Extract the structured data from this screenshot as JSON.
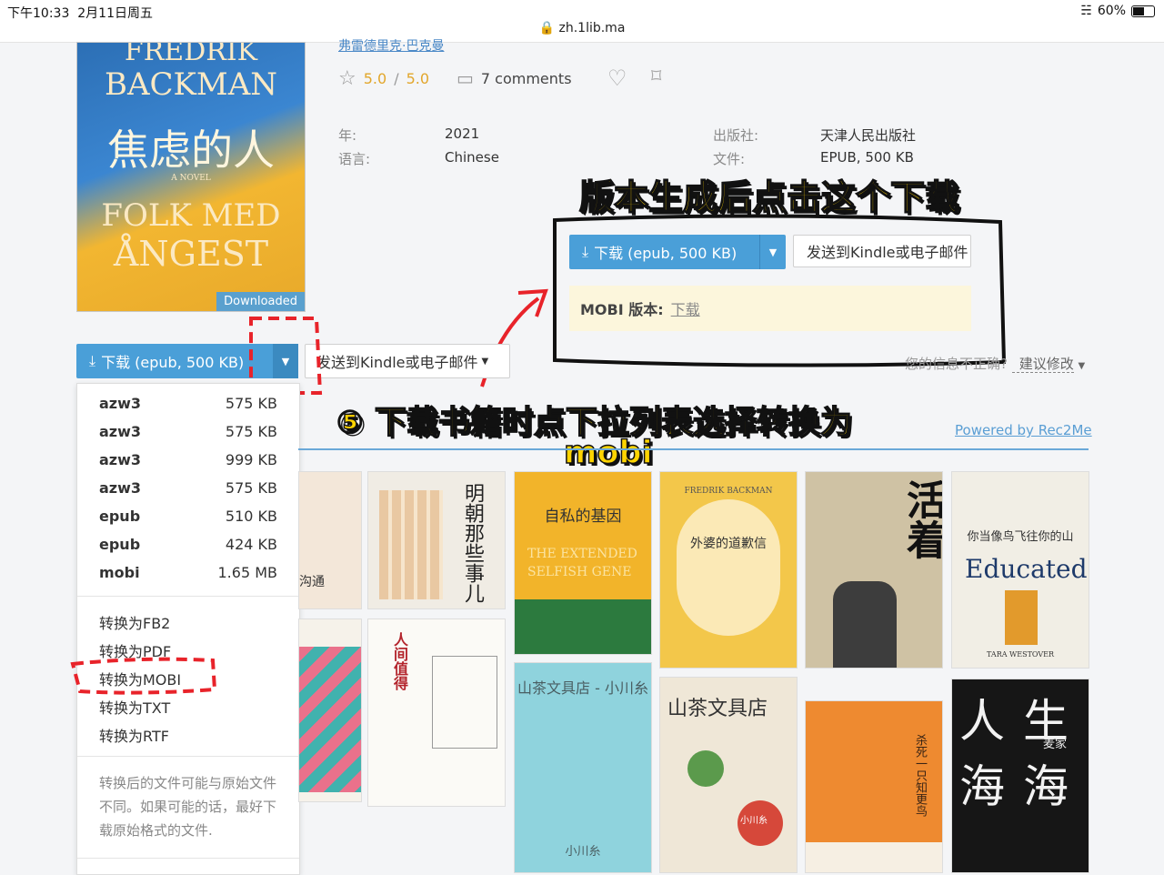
{
  "status": {
    "time": "下午10:33",
    "date": "2月11日周五",
    "url": "zh.1lib.ma",
    "battery": "60%"
  },
  "book": {
    "cover": {
      "author_line1": "FREDRIK",
      "author_line2": "BACKMAN",
      "cn_title": "焦虑的人",
      "small": "A NOVEL",
      "title_line1": "FOLK MED",
      "title_line2": "ÅNGEST",
      "badge": "Downloaded"
    },
    "author_link": "弗雷德里克·巴克曼",
    "rating": "5.0",
    "rating_sep": "/",
    "rating_max": "5.0",
    "comments": "7 comments",
    "meta": [
      {
        "label": "年:",
        "value": "2021"
      },
      {
        "label": "语言:",
        "value": "Chinese"
      },
      {
        "label": "出版社:",
        "value": "天津人民出版社"
      },
      {
        "label": "文件:",
        "value": "EPUB, 500 KB"
      }
    ]
  },
  "download": {
    "label": "下载 (epub, 500 KB)",
    "send_label": "发送到Kindle或电子邮件"
  },
  "callout": {
    "title": "版本生成后点击这个下载",
    "download_label": "下载 (epub, 500 KB)",
    "send_label": "发送到Kindle或电子邮件",
    "mobi_label": "MOBI 版本:",
    "mobi_link": "下载"
  },
  "step_text": "⑤ 下载书籍时点下拉列表选择转换为",
  "step_text2": "mobi",
  "report": {
    "question": "您的信息不正确?",
    "suggest": "建议修改"
  },
  "powered": "Powered by Rec2Me",
  "formats": [
    {
      "format": "azw3",
      "size": "575 KB"
    },
    {
      "format": "azw3",
      "size": "575 KB"
    },
    {
      "format": "azw3",
      "size": "999 KB"
    },
    {
      "format": "azw3",
      "size": "575 KB"
    },
    {
      "format": "epub",
      "size": "510 KB"
    },
    {
      "format": "epub",
      "size": "424 KB"
    },
    {
      "format": "mobi",
      "size": "1.65 MB"
    }
  ],
  "conversions": [
    "转换为FB2",
    "转换为PDF",
    "转换为MOBI",
    "转换为TXT",
    "转换为RTF"
  ],
  "conversion_note": "转换后的文件可能与原始文件不同。如果可能的话，最好下载原始格式的文件.",
  "books": [
    {
      "t1": "沟通"
    },
    {
      "t1": "明朝那些事儿"
    },
    {
      "t1": "自私的基因",
      "t2": "THE EXTENDED",
      "t3": "SELFISH GENE"
    },
    {
      "t1": "外婆的道歉信",
      "t2": "FREDRIK BACKMAN"
    },
    {
      "t1": "活着"
    },
    {
      "t1": "你当像鸟飞往你的山",
      "t2": "Educated",
      "t3": "TARA WESTOVER"
    },
    {
      "t1": "人间值得"
    },
    {
      "t1": "山茶文具店 - 小川糸",
      "t2": "小川糸"
    },
    {
      "t1": "山茶文具店",
      "t2": "小川糸"
    },
    {
      "t1": "杀死一只知更鸟"
    },
    {
      "t1": "人生海海",
      "t2": "麦家"
    }
  ]
}
